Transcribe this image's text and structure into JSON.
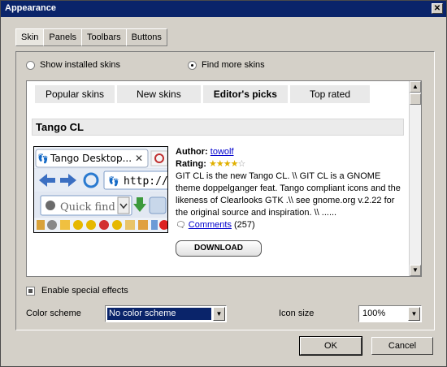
{
  "window": {
    "title": "Appearance",
    "close_glyph": "✕"
  },
  "tabs": [
    {
      "label": "Skin",
      "active": true
    },
    {
      "label": "Panels"
    },
    {
      "label": "Toolbars"
    },
    {
      "label": "Buttons"
    }
  ],
  "source": {
    "installed_label": "Show installed skins",
    "find_label": "Find more skins",
    "selected": "find"
  },
  "skin_tabs": [
    "Popular skins",
    "New skins",
    "Editor's picks",
    "Top rated"
  ],
  "skin": {
    "name": "Tango CL",
    "author_label": "Author:",
    "author": "towolf",
    "rating_label": "Rating:",
    "rating": 4,
    "rating_max": 5,
    "description": "GIT CL is the new Tango CL. \\\\ GIT CL is a GNOME theme doppelganger feat. Tango compliant icons and the likeness of Clearlooks GTK .\\\\ see gnome.org v.2.22 for the original source and inspiration. \\\\ ......",
    "comments_label": "Comments",
    "comments_count": "(257)",
    "download_label": "DOWNLOAD",
    "preview": {
      "tab_title": "Tango Desktop...",
      "address": "http://ta",
      "search_placeholder": "Quick find"
    }
  },
  "effects": {
    "label": "Enable special effects",
    "checked": true
  },
  "color_scheme": {
    "label": "Color scheme",
    "value": "No color scheme"
  },
  "icon_size": {
    "label": "Icon size",
    "value": "100%"
  },
  "buttons": {
    "ok": "OK",
    "cancel": "Cancel"
  },
  "colors": {
    "titlebar": "#0a246a",
    "selection": "#0a246a",
    "face": "#d4d0c8"
  }
}
